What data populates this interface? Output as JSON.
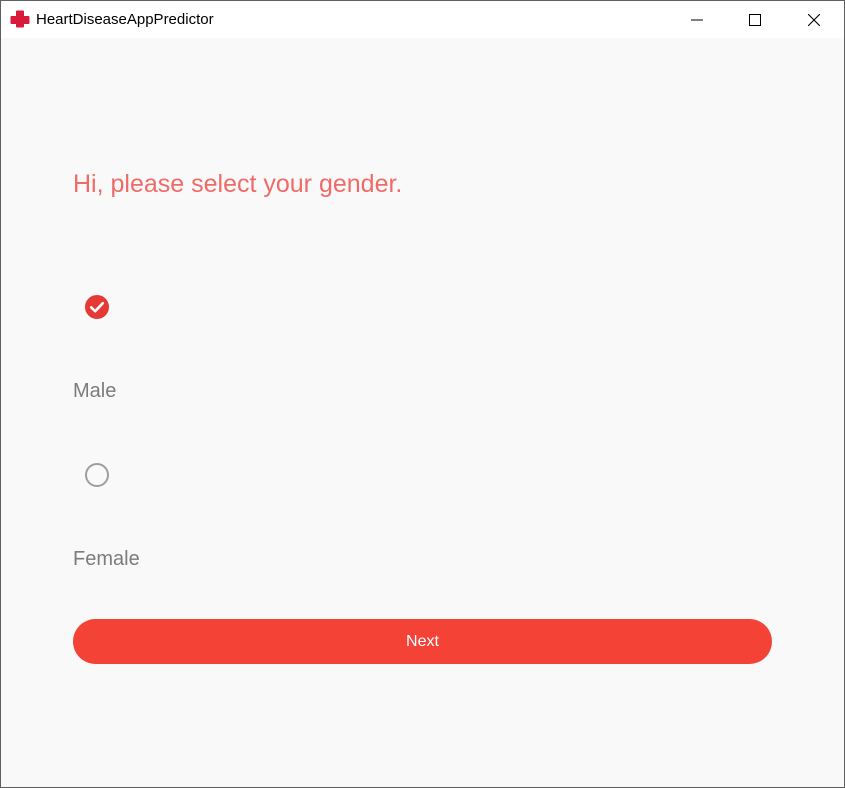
{
  "window": {
    "title": "HeartDiseaseAppPredictor",
    "controls": {
      "minimize": "minimize-icon",
      "maximize": "maximize-icon",
      "close": "close-icon"
    }
  },
  "main": {
    "heading": "Hi, please select your gender.",
    "options": [
      {
        "label": "Male",
        "selected": true
      },
      {
        "label": "Female",
        "selected": false
      }
    ],
    "next_label": "Next"
  },
  "colors": {
    "accent": "#f44336",
    "heading": "#f06a67",
    "label": "#7c7c7c",
    "radio_unselected": "#9e9e9e",
    "background": "#f9f9f9"
  }
}
